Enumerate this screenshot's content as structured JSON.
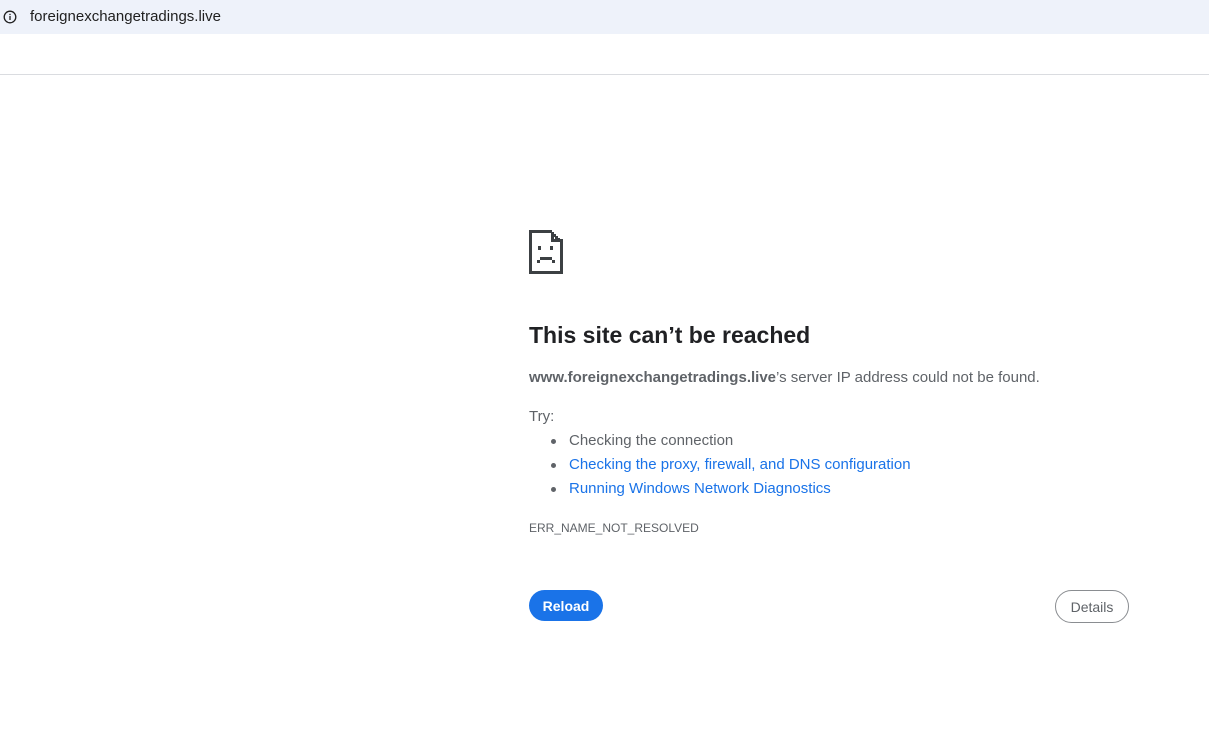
{
  "browser": {
    "url": "foreignexchangetradings.live",
    "icons": {
      "site_info": "info-icon"
    }
  },
  "error_page": {
    "icon": "sad-page-icon",
    "title": "This site can’t be reached",
    "host": "www.foreignexchangetradings.live",
    "summary_suffix": "’s server IP address could not be found.",
    "try_label": "Try:",
    "suggestions": [
      {
        "label": "Checking the connection",
        "is_link": false
      },
      {
        "label": "Checking the proxy, firewall, and DNS configuration",
        "is_link": true
      },
      {
        "label": "Running Windows Network Diagnostics",
        "is_link": true
      }
    ],
    "error_code": "ERR_NAME_NOT_RESOLVED",
    "reload_label": "Reload",
    "details_label": "Details"
  },
  "colors": {
    "address_bar_bg": "#eef2fa",
    "link": "#1a73e8",
    "primary_button": "#1a73e8",
    "secondary_text": "#5f6368"
  }
}
